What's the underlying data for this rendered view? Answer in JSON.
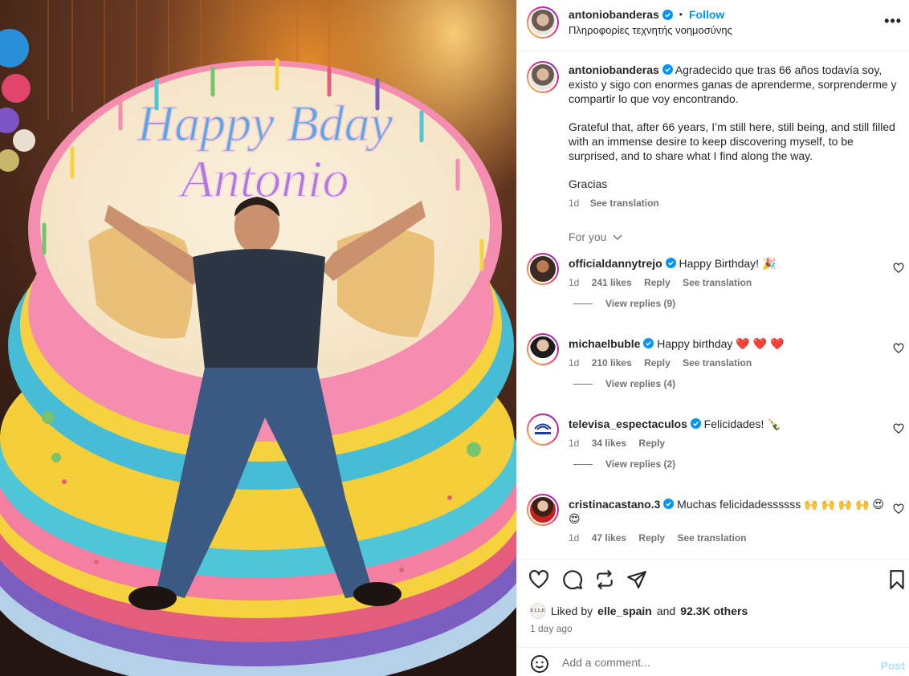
{
  "post": {
    "image_alt": "Man lying in a giant rainbow birthday cake",
    "cake_line1": "Happy Bday",
    "cake_line2": "Antonio"
  },
  "header": {
    "username": "antoniobanderas",
    "dot": "•",
    "follow_label": "Follow",
    "subtitle": "Πληροφορίες τεχνητής νοημοσύνης",
    "more_label": "•••"
  },
  "caption": {
    "username": "antoniobanderas",
    "text_es": "Agradecido que tras 66 años todavía soy, existo y sigo con enormes ganas de aprenderme, sorprenderme y compartir lo que voy encontrando.",
    "text_en": "Grateful that, after 66 years, I’m still here, still being, and still filled with an immense desire to keep discovering myself, to be surprised, and to share what I find along the way.",
    "text_closing": "Gracias",
    "age": "1d",
    "see_translation": "See translation"
  },
  "for_you_label": "For you",
  "comments": [
    {
      "username": "officialdannytrejo",
      "text": "Happy Birthday! 🎉",
      "age": "1d",
      "likes": "241 likes",
      "reply": "Reply",
      "translation": "See translation",
      "view_replies": "View replies (9)"
    },
    {
      "username": "michaelbuble",
      "text": "Happy birthday ❤️ ❤️ ❤️",
      "age": "1d",
      "likes": "210 likes",
      "reply": "Reply",
      "translation": "See translation",
      "view_replies": "View replies (4)"
    },
    {
      "username": "televisa_espectaculos",
      "text": "Felicidades! 🍾",
      "age": "1d",
      "likes": "34 likes",
      "reply": "Reply",
      "view_replies": "View replies (2)"
    },
    {
      "username": "cristinacastano.3",
      "text": "Muchas felicidadessssss 🙌 🙌 🙌 🙌 😍 😍",
      "age": "1d",
      "likes": "47 likes",
      "reply": "Reply",
      "translation": "See translation"
    }
  ],
  "likes": {
    "prefix": "Liked by",
    "user": "elle_spain",
    "and": "and",
    "others": "92.3K others",
    "mini_avatar_text": "ELLE"
  },
  "timestamp": "1 day ago",
  "add_comment": {
    "placeholder": "Add a comment...",
    "post_label": "Post"
  },
  "colors": {
    "link_blue": "#0095f6",
    "muted": "#737373",
    "heart_red": "#ed4956",
    "post_disabled": "#b2dffc"
  },
  "icons": [
    "verified-badge-icon",
    "more-options-icon",
    "heart-icon",
    "comment-icon",
    "repost-icon",
    "share-icon",
    "bookmark-icon",
    "emoji-icon",
    "chevron-down-icon"
  ]
}
